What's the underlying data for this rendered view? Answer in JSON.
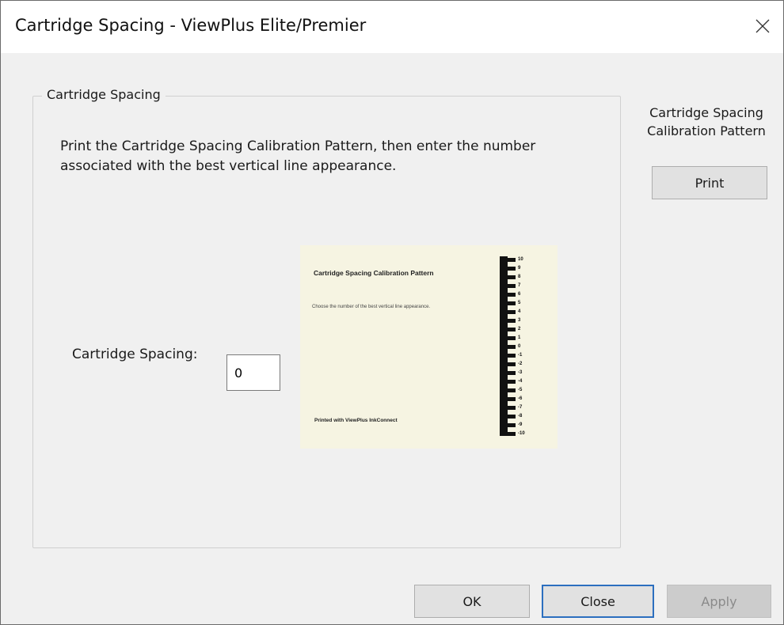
{
  "window": {
    "title": "Cartridge Spacing - ViewPlus Elite/Premier",
    "close_icon": "close-icon"
  },
  "group": {
    "legend": "Cartridge Spacing",
    "instructions": "Print the Cartridge Spacing Calibration Pattern, then enter the number associated with the best vertical line appearance.",
    "spacing_label": "Cartridge Spacing:",
    "spacing_value": "0"
  },
  "pattern_image": {
    "title": "Cartridge Spacing Calibration Pattern",
    "description": "Choose the number of the best vertical line appearance.",
    "footer": "Printed with ViewPlus InkConnect",
    "scale": [
      "10",
      "9",
      "8",
      "7",
      "6",
      "5",
      "4",
      "3",
      "2",
      "1",
      "0",
      "-1",
      "-2",
      "-3",
      "-4",
      "-5",
      "-6",
      "-7",
      "-8",
      "-9",
      "-10"
    ]
  },
  "side_panel": {
    "label": "Cartridge Spacing Calibration Pattern",
    "print_label": "Print"
  },
  "footer_buttons": {
    "ok_label": "OK",
    "close_label": "Close",
    "apply_label": "Apply"
  },
  "colors": {
    "focus_border": "#2c6fbf",
    "pattern_paper": "#f6f4e2"
  }
}
